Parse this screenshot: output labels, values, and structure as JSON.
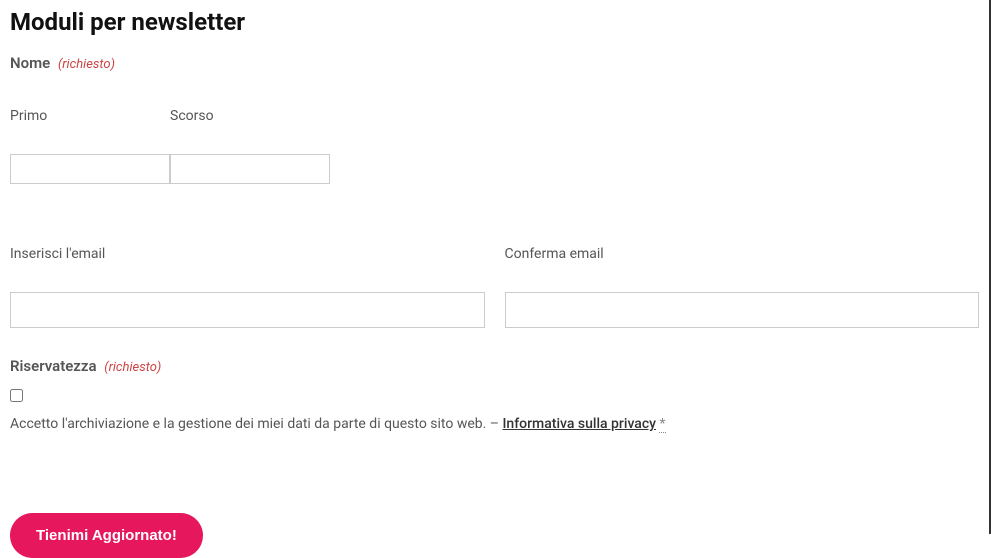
{
  "title": "Moduli per newsletter",
  "name_section": {
    "label": "Nome",
    "required_text": "(richiesto)",
    "first_label": "Primo",
    "last_label": "Scorso"
  },
  "email_section": {
    "enter_label": "Inserisci l'email",
    "confirm_label": "Conferma email"
  },
  "privacy_section": {
    "label": "Riservatezza",
    "required_text": "(richiesto)",
    "consent_text": "Accetto l'archiviazione e la gestione dei miei dati da parte di questo sito web. – ",
    "link_text": "Informativa sulla privacy",
    "asterisk": "*"
  },
  "submit_label": "Tienimi Aggiornato!"
}
